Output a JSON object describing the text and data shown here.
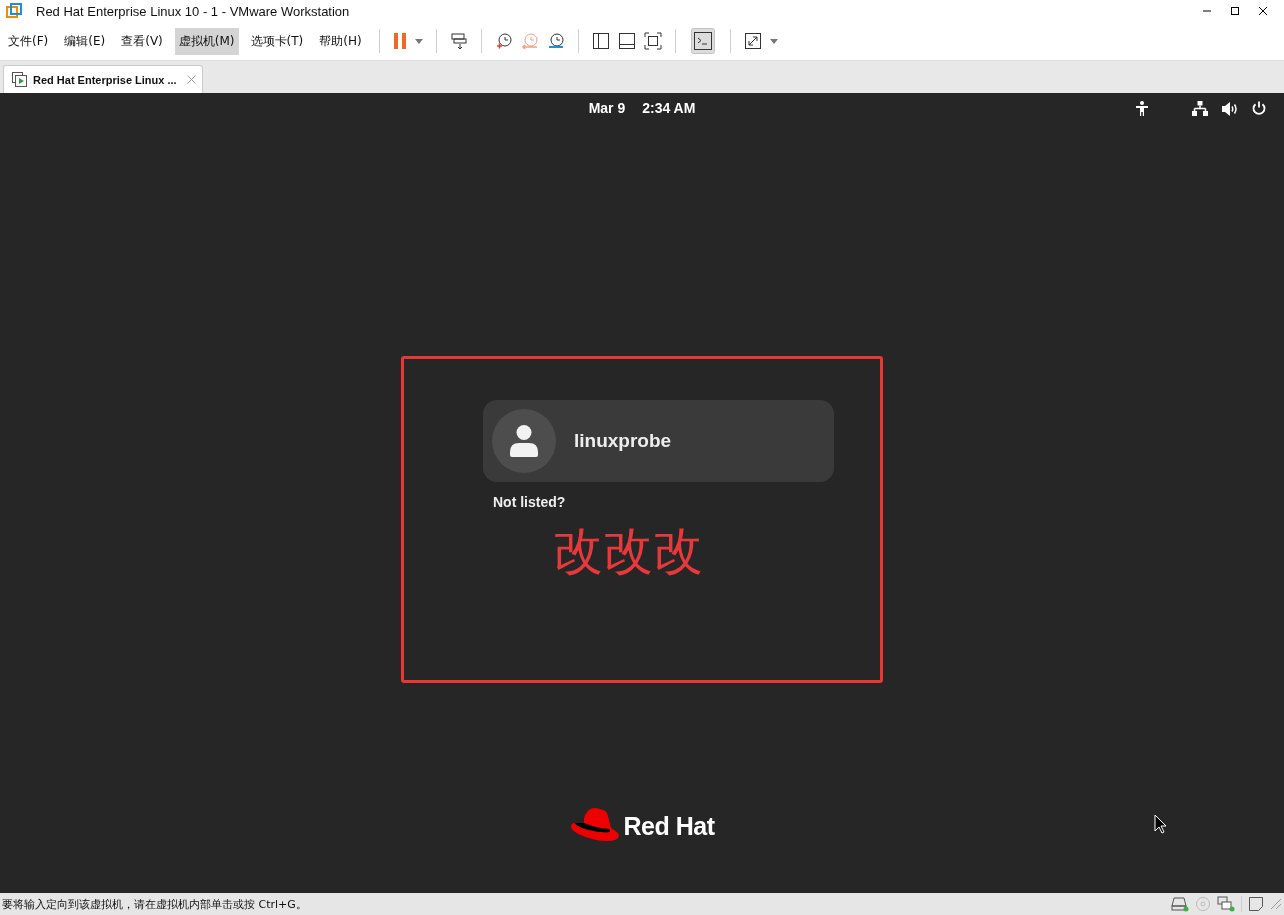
{
  "window": {
    "title": "Red Hat Enterprise Linux 10 - 1 - VMware Workstation"
  },
  "menu": [
    {
      "label": "文件(F)",
      "selected": false
    },
    {
      "label": "编辑(E)",
      "selected": false
    },
    {
      "label": "查看(V)",
      "selected": false
    },
    {
      "label": "虚拟机(M)",
      "selected": true
    },
    {
      "label": "选项卡(T)",
      "selected": false
    },
    {
      "label": "帮助(H)",
      "selected": false
    }
  ],
  "tabs": [
    {
      "label": "Red Hat Enterprise Linux ...",
      "selected": true
    }
  ],
  "vm_screen": {
    "top_bar": {
      "date": "Mar 9",
      "time": "2:34 AM"
    },
    "users": [
      {
        "name": "linuxprobe"
      }
    ],
    "not_listed": "Not listed?",
    "logo_text": "Red Hat"
  },
  "annotation": {
    "text": "改改改"
  },
  "status_bar": {
    "message": "要将输入定向到该虚拟机，请在虚拟机内部单击或按 Ctrl+G。"
  }
}
